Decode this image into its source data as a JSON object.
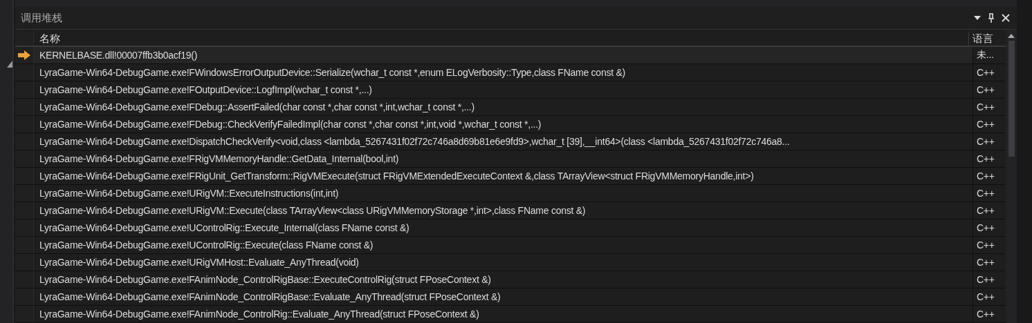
{
  "panel": {
    "title": "调用堆栈"
  },
  "columns": [
    "名称",
    "语言"
  ],
  "frames": [
    {
      "name": "KERNELBASE.dll!00007ffb3b0acf19()",
      "language": "未...",
      "current": true
    },
    {
      "name": "LyraGame-Win64-DebugGame.exe!FWindowsErrorOutputDevice::Serialize(wchar_t const *,enum ELogVerbosity::Type,class FName const &)",
      "language": "C++",
      "current": false
    },
    {
      "name": "LyraGame-Win64-DebugGame.exe!FOutputDevice::LogfImpl(wchar_t const *,...)",
      "language": "C++",
      "current": false
    },
    {
      "name": "LyraGame-Win64-DebugGame.exe!FDebug::AssertFailed(char const *,char const *,int,wchar_t const *,...)",
      "language": "C++",
      "current": false
    },
    {
      "name": "LyraGame-Win64-DebugGame.exe!FDebug::CheckVerifyFailedImpl(char const *,char const *,int,void *,wchar_t const *,...)",
      "language": "C++",
      "current": false
    },
    {
      "name": "LyraGame-Win64-DebugGame.exe!DispatchCheckVerify<void,class <lambda_5267431f02f72c746a8d69b81e6e9fd9>,wchar_t [39],__int64>(class <lambda_5267431f02f72c746a8...",
      "language": "C++",
      "current": false
    },
    {
      "name": "LyraGame-Win64-DebugGame.exe!FRigVMMemoryHandle::GetData_Internal(bool,int)",
      "language": "C++",
      "current": false
    },
    {
      "name": "LyraGame-Win64-DebugGame.exe!FRigUnit_GetTransform::RigVMExecute(struct FRigVMExtendedExecuteContext &,class TArrayView<struct FRigVMMemoryHandle,int>)",
      "language": "C++",
      "current": false
    },
    {
      "name": "LyraGame-Win64-DebugGame.exe!URigVM::ExecuteInstructions(int,int)",
      "language": "C++",
      "current": false
    },
    {
      "name": "LyraGame-Win64-DebugGame.exe!URigVM::Execute(class TArrayView<class URigVMMemoryStorage *,int>,class FName const &)",
      "language": "C++",
      "current": false
    },
    {
      "name": "LyraGame-Win64-DebugGame.exe!UControlRig::Execute_Internal(class FName const &)",
      "language": "C++",
      "current": false
    },
    {
      "name": "LyraGame-Win64-DebugGame.exe!UControlRig::Execute(class FName const &)",
      "language": "C++",
      "current": false
    },
    {
      "name": "LyraGame-Win64-DebugGame.exe!URigVMHost::Evaluate_AnyThread(void)",
      "language": "C++",
      "current": false
    },
    {
      "name": "LyraGame-Win64-DebugGame.exe!FAnimNode_ControlRigBase::ExecuteControlRig(struct FPoseContext &)",
      "language": "C++",
      "current": false
    },
    {
      "name": "LyraGame-Win64-DebugGame.exe!FAnimNode_ControlRigBase::Evaluate_AnyThread(struct FPoseContext &)",
      "language": "C++",
      "current": false
    },
    {
      "name": "LyraGame-Win64-DebugGame.exe!FAnimNode_ControlRig::Evaluate_AnyThread(struct FPoseContext &)",
      "language": "C++",
      "current": false
    }
  ]
}
